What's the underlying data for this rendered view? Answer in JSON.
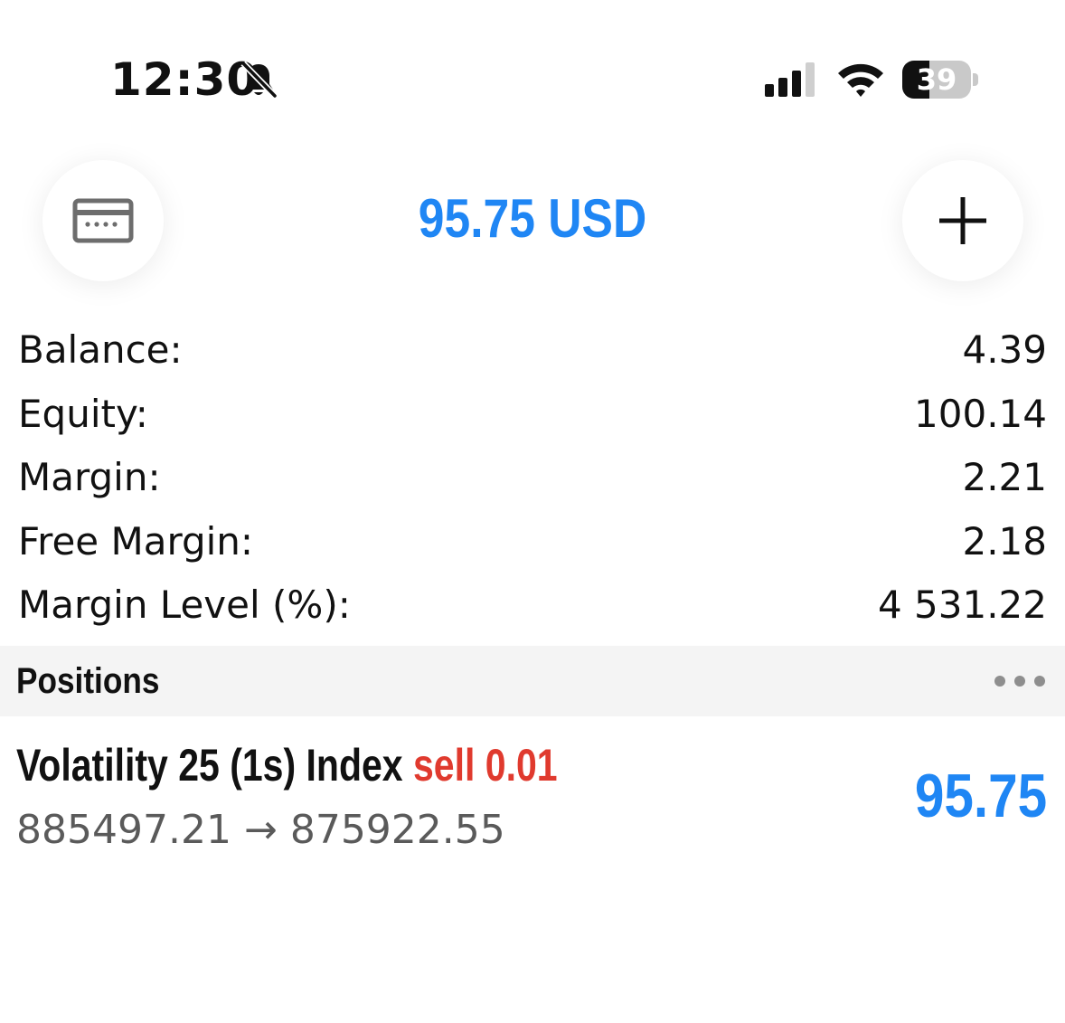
{
  "status_bar": {
    "time": "12:30",
    "battery_level": 39,
    "battery_text": "39"
  },
  "header": {
    "total": "95.75 USD",
    "accent_color": "#1f86f4"
  },
  "summary": {
    "rows": [
      {
        "label": "Balance:",
        "value": "4.39"
      },
      {
        "label": "Equity:",
        "value": "100.14"
      },
      {
        "label": "Margin:",
        "value": "2.21"
      },
      {
        "label": "Free Margin:",
        "value": "2.18"
      },
      {
        "label": "Margin Level (%):",
        "value": "4 531.22"
      }
    ]
  },
  "positions": {
    "title": "Positions",
    "items": [
      {
        "symbol": "Volatility 25 (1s) Index",
        "side": "sell 0.01",
        "open_price": "885497.21",
        "arrow": "→",
        "current_price": "875922.55",
        "profit": "95.75",
        "side_color": "#e03a2e"
      }
    ]
  },
  "icons": {
    "wallet": "credit-card-icon",
    "add": "plus-icon",
    "more": "ellipsis-icon",
    "bell": "bell-slash-icon",
    "signal": "cellular-signal-icon",
    "wifi": "wifi-icon"
  }
}
